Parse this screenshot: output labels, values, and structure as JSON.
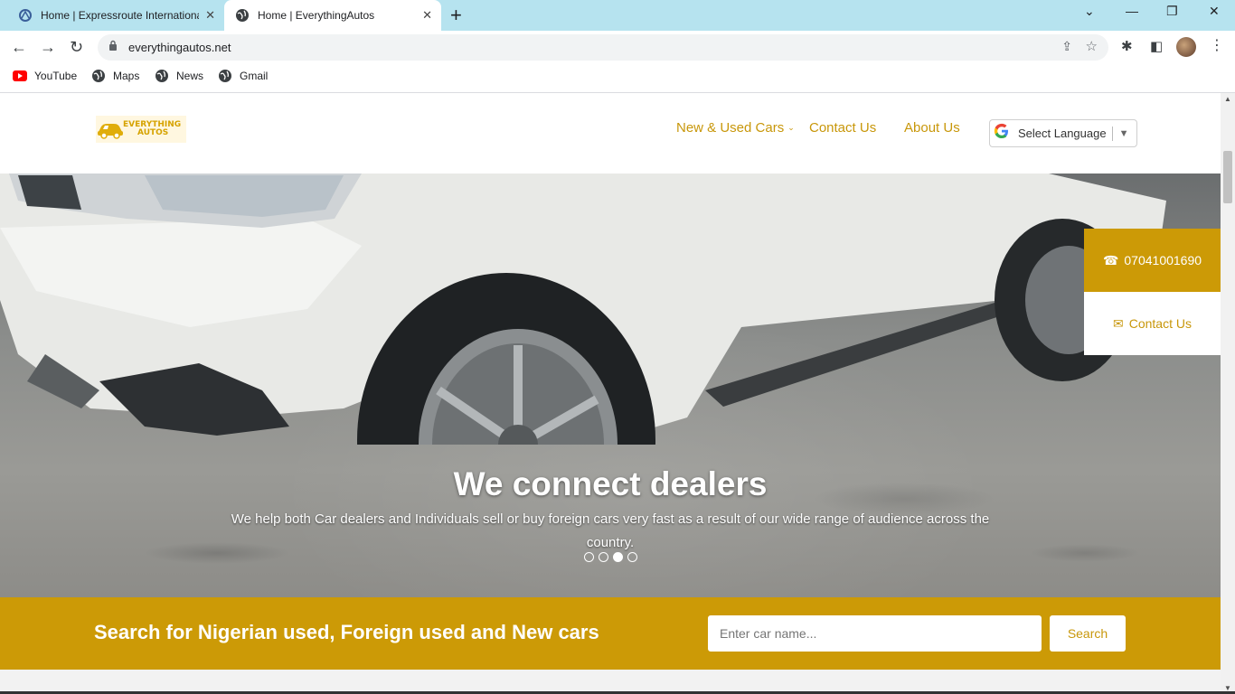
{
  "browser": {
    "tabs": [
      {
        "title": "Home | Expressroute International",
        "active": false
      },
      {
        "title": "Home | EverythingAutos",
        "active": true
      }
    ],
    "url": "everythingautos.net",
    "bookmarks": [
      "YouTube",
      "Maps",
      "News",
      "Gmail"
    ]
  },
  "site": {
    "logo": {
      "line1": "EVERYTHING",
      "line2": "AUTOS"
    },
    "nav": {
      "new_used": "New & Used Cars",
      "contact": "Contact Us",
      "about": "About Us"
    },
    "language": {
      "label": "Select Language",
      "g": "G"
    }
  },
  "hero": {
    "title": "We connect dealers",
    "text": "We help both Car dealers and Individuals sell or buy foreign cars very fast as a result of our wide range of audience across the country.",
    "slides": 4,
    "active_slide": 3
  },
  "floating": {
    "phone": "07041001690",
    "contact": "Contact Us"
  },
  "search": {
    "heading": "Search for Nigerian used, Foreign used and New cars",
    "placeholder": "Enter car name...",
    "button": "Search"
  },
  "colors": {
    "brand": "#cc9a06",
    "chrome_tabstrip": "#b6e3ef"
  }
}
